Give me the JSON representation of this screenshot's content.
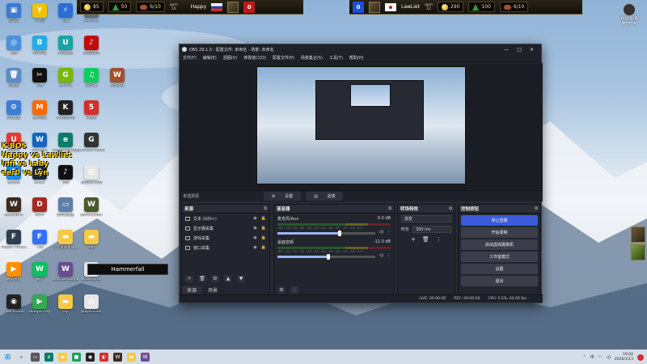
{
  "desktop_icons": [
    {
      "label": "此电脑",
      "color": "#3a7bd5",
      "glyph": "▣",
      "col": 0,
      "row": 0
    },
    {
      "label": "YY语音",
      "color": "#f2c200",
      "glyph": "Y",
      "col": 1,
      "row": 0
    },
    {
      "label": "迅雷",
      "color": "#2a6fd6",
      "glyph": "⚡",
      "col": 2,
      "row": 0
    },
    {
      "label": "Storm-Lo",
      "color": "#5d6d7e",
      "glyph": "S",
      "col": 3,
      "row": 0
    },
    {
      "label": "网络",
      "color": "#4a90e2",
      "glyph": "◎",
      "col": 0,
      "row": 1
    },
    {
      "label": "哔哩哔哩",
      "color": "#23ade5",
      "glyph": "B",
      "col": 1,
      "row": 1
    },
    {
      "label": "UU加速器",
      "color": "#1aa3a3",
      "glyph": "U",
      "col": 2,
      "row": 1
    },
    {
      "label": "网易云音乐",
      "color": "#c20c0c",
      "glyph": "♪",
      "col": 3,
      "row": 1
    },
    {
      "label": "回收站",
      "color": "#5b8cc9",
      "glyph": "🗑",
      "col": 0,
      "row": 2
    },
    {
      "label": "剪映",
      "color": "#111",
      "glyph": "✂",
      "col": 1,
      "row": 2
    },
    {
      "label": "GeForce",
      "color": "#76b900",
      "glyph": "G",
      "col": 2,
      "row": 2
    },
    {
      "label": "QQ音乐",
      "color": "#0ccf5b",
      "glyph": "♫",
      "col": 3,
      "row": 2
    },
    {
      "label": "网易游戏",
      "color": "#a0522d",
      "glyph": "W",
      "col": 4,
      "row": 2
    },
    {
      "label": "控制面板",
      "color": "#3b7dd8",
      "glyph": "⚙",
      "col": 0,
      "row": 3
    },
    {
      "label": "腾讯会议",
      "color": "#ff6a00",
      "glyph": "M",
      "col": 1,
      "row": 3
    },
    {
      "label": "KK对战平台",
      "color": "#222",
      "glyph": "K",
      "col": 2,
      "row": 3
    },
    {
      "label": "52战网",
      "color": "#d32f2f",
      "glyph": "5",
      "col": 3,
      "row": 3
    },
    {
      "label": "网易UU",
      "color": "#e53935",
      "glyph": "U",
      "col": 0,
      "row": 4
    },
    {
      "label": "WeGame",
      "color": "#1565c0",
      "glyph": "W",
      "col": 1,
      "row": 4
    },
    {
      "label": "Microsoft Edge",
      "color": "#0f7b6c",
      "glyph": "e",
      "col": 2,
      "row": 4
    },
    {
      "label": "Glorious Model",
      "color": "#333",
      "glyph": "G",
      "col": 3,
      "row": 4
    },
    {
      "label": "腾讯QQ",
      "color": "#1e88e5",
      "glyph": "Q",
      "col": 0,
      "row": 5
    },
    {
      "label": "Steam",
      "color": "#1b2838",
      "glyph": "S",
      "col": 1,
      "row": 5
    },
    {
      "label": "抖音",
      "color": "#111",
      "glyph": "♪",
      "col": 2,
      "row": 5
    },
    {
      "label": "新建文本文档",
      "color": "#e6e6e6",
      "glyph": "▤",
      "col": 3,
      "row": 5
    },
    {
      "label": "Warcraft III",
      "color": "#3d2b1f",
      "glyph": "W",
      "col": 0,
      "row": 6
    },
    {
      "label": "DOTA",
      "color": "#a62a22",
      "glyph": "D",
      "col": 1,
      "row": 6
    },
    {
      "label": "显示器设置",
      "color": "#5e7fa8",
      "glyph": "▭",
      "col": 2,
      "row": 6
    },
    {
      "label": "World Editor",
      "color": "#4a5a2a",
      "glyph": "W",
      "col": 3,
      "row": 6
    },
    {
      "label": "Frozen Throne",
      "color": "#2c3e50",
      "glyph": "F",
      "col": 0,
      "row": 7
    },
    {
      "label": "飞书",
      "color": "#3370ff",
      "glyph": "F",
      "col": 1,
      "row": 7
    },
    {
      "label": "文件资源管理器",
      "color": "#f7c948",
      "glyph": "▬",
      "col": 2,
      "row": 7
    },
    {
      "label": "logs",
      "color": "#f7c948",
      "glyph": "▬",
      "col": 3,
      "row": 7
    },
    {
      "label": "腾讯视频",
      "color": "#ff8f00",
      "glyph": "▶",
      "col": 0,
      "row": 8
    },
    {
      "label": "微信",
      "color": "#07c160",
      "glyph": "W",
      "col": 1,
      "row": 8
    },
    {
      "label": "W3Champions",
      "color": "#6a4c93",
      "glyph": "W",
      "col": 2,
      "row": 8
    },
    {
      "label": "Screenshot",
      "color": "#e6e6e6",
      "glyph": "▤",
      "col": 3,
      "row": 8
    },
    {
      "label": "OBS Studio",
      "color": "#222",
      "glyph": "◉",
      "col": 0,
      "row": 9
    },
    {
      "label": "Google Play",
      "color": "#34a853",
      "glyph": "▶",
      "col": 1,
      "row": 9
    },
    {
      "label": "ny",
      "color": "#f7c948",
      "glyph": "▬",
      "col": 2,
      "row": 9
    },
    {
      "label": "playerstats",
      "color": "#e6e6e6",
      "glyph": "▤",
      "col": 3,
      "row": 9
    }
  ],
  "hud_left": {
    "gold": "85",
    "lumber": "50",
    "food": "6/10",
    "time_label": "apm",
    "time_value": "10",
    "player": "Happy",
    "score": "0"
  },
  "hud_right": {
    "score": "0",
    "player": "LawLiet",
    "apm_label": "apm",
    "apm_value": "22",
    "gold": "290",
    "lumber": "100",
    "food": "6/10"
  },
  "stream_overlay": {
    "line1": "K-BO5",
    "line2": "Happy vs Lawliet",
    "line3": "Infi vs Laby",
    "line4": "eer0 vs Lyn"
  },
  "hammerfall_label": "Hammerfall",
  "right_widget": {
    "label": "7K标准2服",
    "sub": "剩余时间"
  },
  "obs": {
    "title": "OBS 29.1.3 - 配置文件: 未命名 - 场景: 未命名",
    "menus": [
      "文件(F)",
      "编辑(E)",
      "视图(V)",
      "停靠窗口(D)",
      "配置文件(P)",
      "场景集合(S)",
      "工具(T)",
      "帮助(H)"
    ],
    "no_source": "未选择源",
    "props_btn": "设置",
    "filters_btn": "滤镜",
    "sources_title": "来源",
    "sources": [
      {
        "name": "文本 (GDI+)"
      },
      {
        "name": "显示器采集"
      },
      {
        "name": "游戏采集"
      },
      {
        "name": "窗口采集"
      }
    ],
    "scene_tab": "来源",
    "scene_tab2": "场景",
    "mixer_title": "混音器",
    "mixer": [
      {
        "name": "麦克风/Aux",
        "db": "0.0 dB",
        "level": 0.62
      },
      {
        "name": "桌面音频",
        "db": "-11.0 dB",
        "level": 0.5
      }
    ],
    "mixer_scale": "-60 -55 -50 -45 -40 -35 -30 -25 -20 -15 -10 -5 0",
    "transitions_title": "转场特效",
    "transition_type": "渐变",
    "duration_label": "时长",
    "duration_value": "300 ms",
    "controls_title": "控制按钮",
    "controls": [
      {
        "label": "停止直播",
        "primary": true
      },
      {
        "label": "开始录制",
        "primary": false
      },
      {
        "label": "启动虚拟摄像机",
        "primary": false
      },
      {
        "label": "工作室模式",
        "primary": false
      },
      {
        "label": "设置",
        "primary": false
      },
      {
        "label": "退出",
        "primary": false
      }
    ],
    "status_live": "LIVE: 00:00:00",
    "status_rec": "REC: 00:00:00",
    "status_cpu": "CPU: 0.5%, 60.00 fps"
  },
  "taskbar": {
    "time": "19:02",
    "date": "2026/1/13",
    "lang": "中"
  }
}
